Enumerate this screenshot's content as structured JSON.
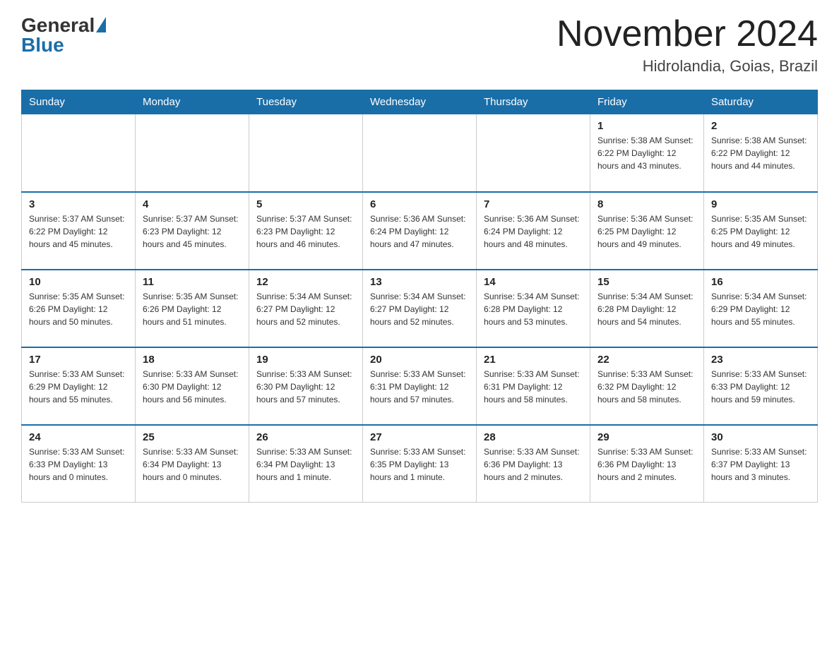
{
  "logo": {
    "general": "General",
    "blue": "Blue"
  },
  "header": {
    "title": "November 2024",
    "location": "Hidrolandia, Goias, Brazil"
  },
  "weekdays": [
    "Sunday",
    "Monday",
    "Tuesday",
    "Wednesday",
    "Thursday",
    "Friday",
    "Saturday"
  ],
  "weeks": [
    [
      {
        "day": "",
        "info": ""
      },
      {
        "day": "",
        "info": ""
      },
      {
        "day": "",
        "info": ""
      },
      {
        "day": "",
        "info": ""
      },
      {
        "day": "",
        "info": ""
      },
      {
        "day": "1",
        "info": "Sunrise: 5:38 AM\nSunset: 6:22 PM\nDaylight: 12 hours and 43 minutes."
      },
      {
        "day": "2",
        "info": "Sunrise: 5:38 AM\nSunset: 6:22 PM\nDaylight: 12 hours and 44 minutes."
      }
    ],
    [
      {
        "day": "3",
        "info": "Sunrise: 5:37 AM\nSunset: 6:22 PM\nDaylight: 12 hours and 45 minutes."
      },
      {
        "day": "4",
        "info": "Sunrise: 5:37 AM\nSunset: 6:23 PM\nDaylight: 12 hours and 45 minutes."
      },
      {
        "day": "5",
        "info": "Sunrise: 5:37 AM\nSunset: 6:23 PM\nDaylight: 12 hours and 46 minutes."
      },
      {
        "day": "6",
        "info": "Sunrise: 5:36 AM\nSunset: 6:24 PM\nDaylight: 12 hours and 47 minutes."
      },
      {
        "day": "7",
        "info": "Sunrise: 5:36 AM\nSunset: 6:24 PM\nDaylight: 12 hours and 48 minutes."
      },
      {
        "day": "8",
        "info": "Sunrise: 5:36 AM\nSunset: 6:25 PM\nDaylight: 12 hours and 49 minutes."
      },
      {
        "day": "9",
        "info": "Sunrise: 5:35 AM\nSunset: 6:25 PM\nDaylight: 12 hours and 49 minutes."
      }
    ],
    [
      {
        "day": "10",
        "info": "Sunrise: 5:35 AM\nSunset: 6:26 PM\nDaylight: 12 hours and 50 minutes."
      },
      {
        "day": "11",
        "info": "Sunrise: 5:35 AM\nSunset: 6:26 PM\nDaylight: 12 hours and 51 minutes."
      },
      {
        "day": "12",
        "info": "Sunrise: 5:34 AM\nSunset: 6:27 PM\nDaylight: 12 hours and 52 minutes."
      },
      {
        "day": "13",
        "info": "Sunrise: 5:34 AM\nSunset: 6:27 PM\nDaylight: 12 hours and 52 minutes."
      },
      {
        "day": "14",
        "info": "Sunrise: 5:34 AM\nSunset: 6:28 PM\nDaylight: 12 hours and 53 minutes."
      },
      {
        "day": "15",
        "info": "Sunrise: 5:34 AM\nSunset: 6:28 PM\nDaylight: 12 hours and 54 minutes."
      },
      {
        "day": "16",
        "info": "Sunrise: 5:34 AM\nSunset: 6:29 PM\nDaylight: 12 hours and 55 minutes."
      }
    ],
    [
      {
        "day": "17",
        "info": "Sunrise: 5:33 AM\nSunset: 6:29 PM\nDaylight: 12 hours and 55 minutes."
      },
      {
        "day": "18",
        "info": "Sunrise: 5:33 AM\nSunset: 6:30 PM\nDaylight: 12 hours and 56 minutes."
      },
      {
        "day": "19",
        "info": "Sunrise: 5:33 AM\nSunset: 6:30 PM\nDaylight: 12 hours and 57 minutes."
      },
      {
        "day": "20",
        "info": "Sunrise: 5:33 AM\nSunset: 6:31 PM\nDaylight: 12 hours and 57 minutes."
      },
      {
        "day": "21",
        "info": "Sunrise: 5:33 AM\nSunset: 6:31 PM\nDaylight: 12 hours and 58 minutes."
      },
      {
        "day": "22",
        "info": "Sunrise: 5:33 AM\nSunset: 6:32 PM\nDaylight: 12 hours and 58 minutes."
      },
      {
        "day": "23",
        "info": "Sunrise: 5:33 AM\nSunset: 6:33 PM\nDaylight: 12 hours and 59 minutes."
      }
    ],
    [
      {
        "day": "24",
        "info": "Sunrise: 5:33 AM\nSunset: 6:33 PM\nDaylight: 13 hours and 0 minutes."
      },
      {
        "day": "25",
        "info": "Sunrise: 5:33 AM\nSunset: 6:34 PM\nDaylight: 13 hours and 0 minutes."
      },
      {
        "day": "26",
        "info": "Sunrise: 5:33 AM\nSunset: 6:34 PM\nDaylight: 13 hours and 1 minute."
      },
      {
        "day": "27",
        "info": "Sunrise: 5:33 AM\nSunset: 6:35 PM\nDaylight: 13 hours and 1 minute."
      },
      {
        "day": "28",
        "info": "Sunrise: 5:33 AM\nSunset: 6:36 PM\nDaylight: 13 hours and 2 minutes."
      },
      {
        "day": "29",
        "info": "Sunrise: 5:33 AM\nSunset: 6:36 PM\nDaylight: 13 hours and 2 minutes."
      },
      {
        "day": "30",
        "info": "Sunrise: 5:33 AM\nSunset: 6:37 PM\nDaylight: 13 hours and 3 minutes."
      }
    ]
  ]
}
